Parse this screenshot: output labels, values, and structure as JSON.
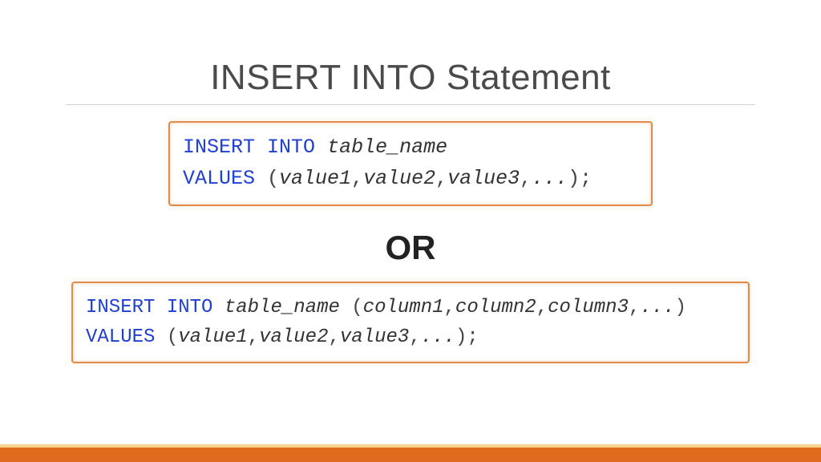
{
  "title": "INSERT INTO Statement",
  "separator": "OR",
  "code1": {
    "l1_kw1": "INSERT",
    "l1_kw2": "INTO",
    "l1_id1": "table_name",
    "l2_kw1": "VALUES",
    "l2_p1": " (",
    "l2_id1": "value1",
    "l2_c1": ",",
    "l2_id2": "value2",
    "l2_c2": ",",
    "l2_id3": "value3",
    "l2_c3": ",",
    "l2_id4": "...",
    "l2_p2": ");"
  },
  "code2": {
    "l1_kw1": "INSERT",
    "l1_kw2": "INTO",
    "l1_id1": "table_name",
    "l1_p1": " (",
    "l1_id2": "column1",
    "l1_c1": ",",
    "l1_id3": "column2",
    "l1_c2": ",",
    "l1_id4": "column3",
    "l1_c3": ",",
    "l1_id5": "...",
    "l1_p2": ")",
    "l2_kw1": "VALUES",
    "l2_p1": " (",
    "l2_id1": "value1",
    "l2_c1": ",",
    "l2_id2": "value2",
    "l2_c2": ",",
    "l2_id3": "value3",
    "l2_c3": ",",
    "l2_id4": "...",
    "l2_p2": ");"
  }
}
